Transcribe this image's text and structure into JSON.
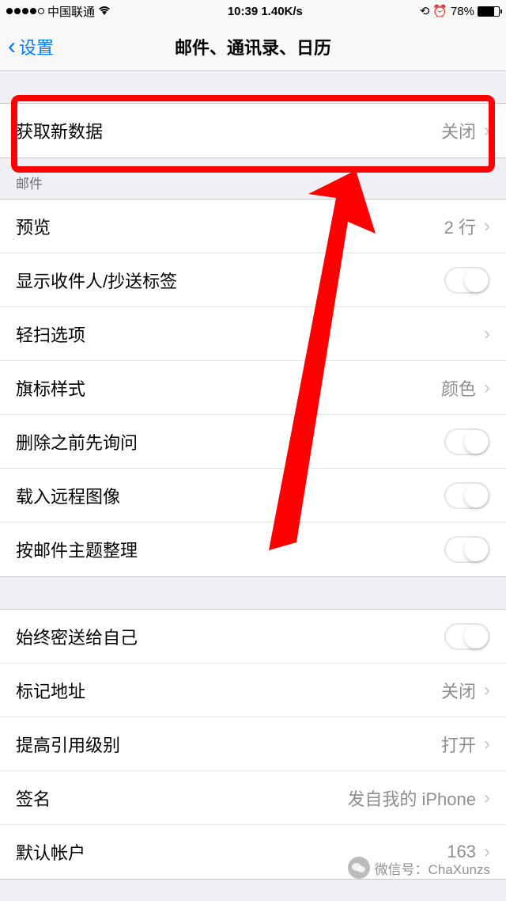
{
  "statusBar": {
    "carrier": "中国联通",
    "time": "10:39 1.40K/s",
    "battery": "78%"
  },
  "nav": {
    "back": "设置",
    "title": "邮件、通讯录、日历"
  },
  "fetchData": {
    "label": "获取新数据",
    "value": "关闭"
  },
  "mailSection": {
    "header": "邮件",
    "preview": {
      "label": "预览",
      "value": "2 行"
    },
    "showToCc": {
      "label": "显示收件人/抄送标签"
    },
    "swipeOptions": {
      "label": "轻扫选项"
    },
    "flagStyle": {
      "label": "旗标样式",
      "value": "颜色"
    },
    "askBeforeDelete": {
      "label": "删除之前先询问"
    },
    "loadRemoteImages": {
      "label": "载入远程图像"
    },
    "organizeByThread": {
      "label": "按邮件主题整理"
    }
  },
  "bottomSection": {
    "alwaysBcc": {
      "label": "始终密送给自己"
    },
    "markAddress": {
      "label": "标记地址",
      "value": "关闭"
    },
    "increaseQuote": {
      "label": "提高引用级别",
      "value": "打开"
    },
    "signature": {
      "label": "签名",
      "value": "发自我的 iPhone"
    },
    "defaultAccount": {
      "label": "默认帐户",
      "value": "163"
    }
  },
  "watermark": {
    "text": "微信号：ChaXunzs"
  }
}
